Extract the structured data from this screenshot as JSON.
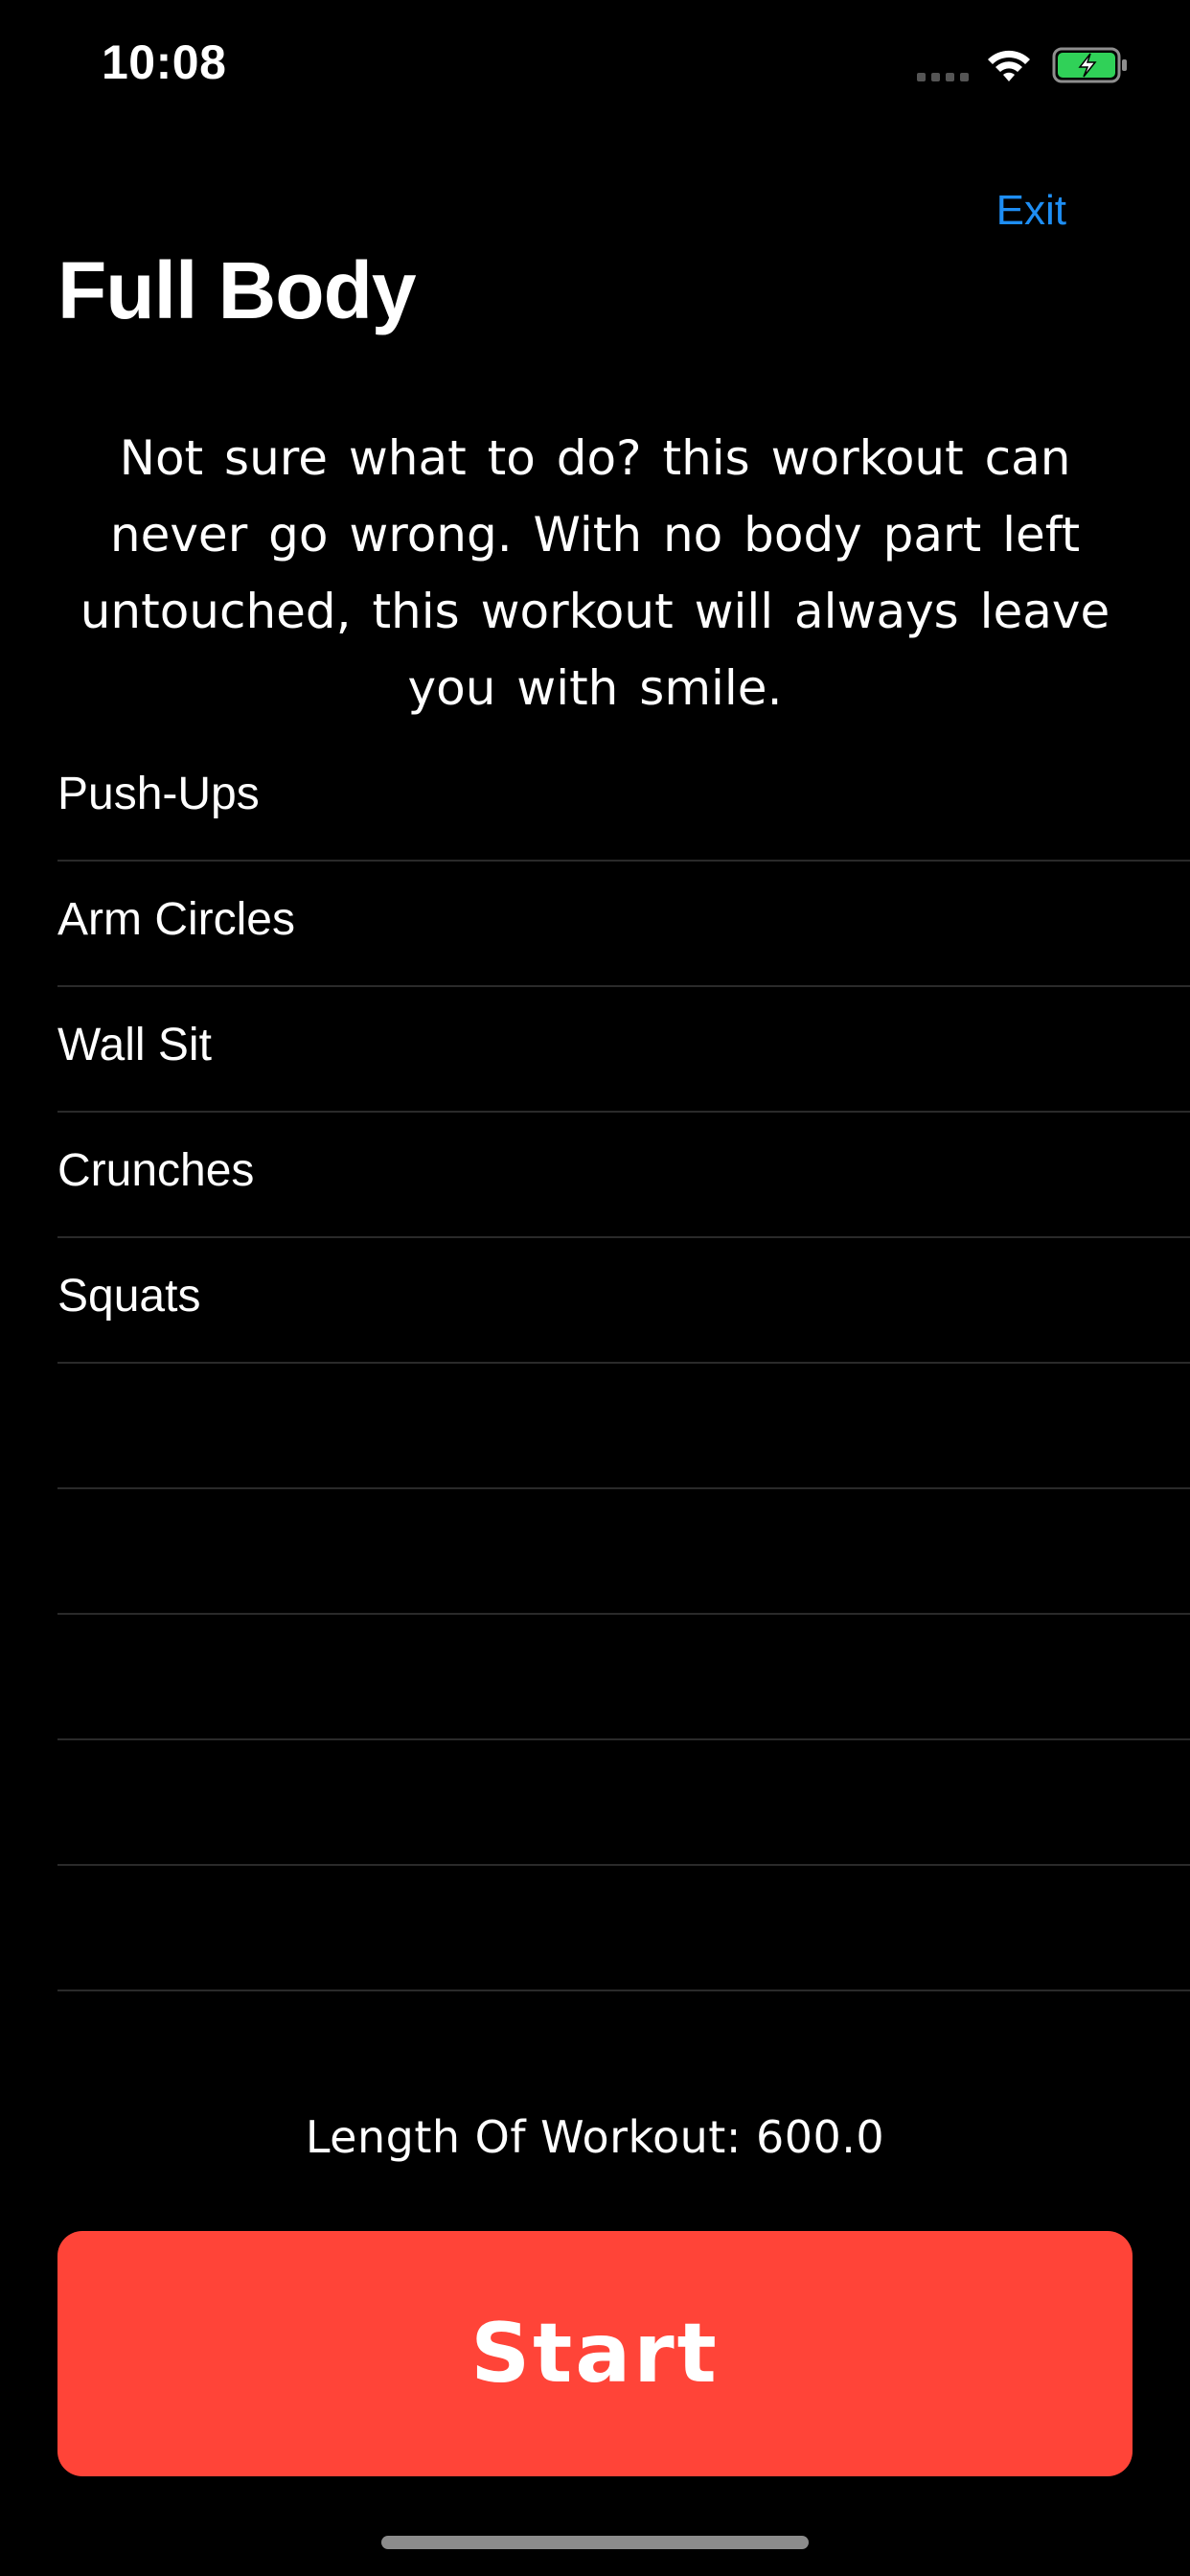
{
  "status_bar": {
    "time": "10:08",
    "icons": [
      "signal-icon",
      "wifi-icon",
      "battery-charging-icon"
    ],
    "battery_color": "#30D158"
  },
  "nav": {
    "exit_label": "Exit",
    "accent_color": "#1E8EF4"
  },
  "workout": {
    "title": "Full Body",
    "description": "Not sure what to do? this workout can never go wrong.  With no body part left untouched, this workout will always leave you with smile.",
    "exercises": [
      {
        "name": "Push-Ups"
      },
      {
        "name": "Arm Circles"
      },
      {
        "name": "Wall Sit"
      },
      {
        "name": "Crunches"
      },
      {
        "name": "Squats"
      },
      {
        "name": ""
      },
      {
        "name": ""
      },
      {
        "name": ""
      },
      {
        "name": ""
      },
      {
        "name": ""
      }
    ],
    "length_text": "Length Of Workout: 600.0"
  },
  "start_button": {
    "label": "Start",
    "color": "#FF4438"
  }
}
